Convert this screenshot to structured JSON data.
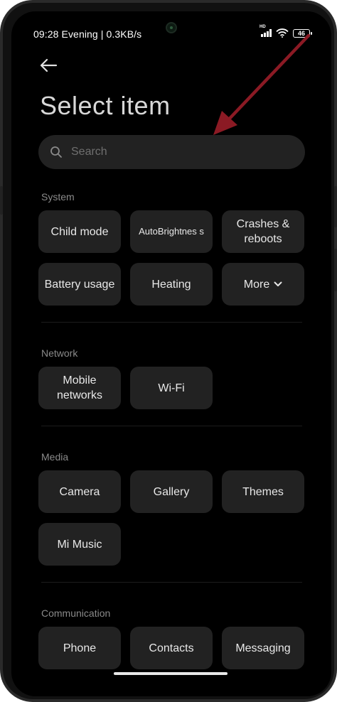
{
  "status_bar": {
    "left_text": "09:28 Evening | 0.3KB/s",
    "network_badge": "HD",
    "battery": "46"
  },
  "header": {
    "title": "Select item"
  },
  "search": {
    "placeholder": "Search"
  },
  "sections": [
    {
      "label": "System",
      "items": [
        "Child mode",
        "AutoBrightnes s",
        "Crashes & reboots",
        "Battery usage",
        "Heating",
        "More"
      ]
    },
    {
      "label": "Network",
      "items": [
        "Mobile networks",
        "Wi-Fi"
      ]
    },
    {
      "label": "Media",
      "items": [
        "Camera",
        "Gallery",
        "Themes",
        "Mi Music"
      ]
    },
    {
      "label": "Communication",
      "items": [
        "Phone",
        "Contacts",
        "Messaging"
      ]
    }
  ],
  "colors": {
    "background": "#000000",
    "tile": "#222222",
    "annotation_arrow": "#8b1a24"
  },
  "icons": [
    "back-arrow-icon",
    "search-icon",
    "chevron-down-icon",
    "signal-icon",
    "wifi-icon",
    "battery-icon"
  ]
}
